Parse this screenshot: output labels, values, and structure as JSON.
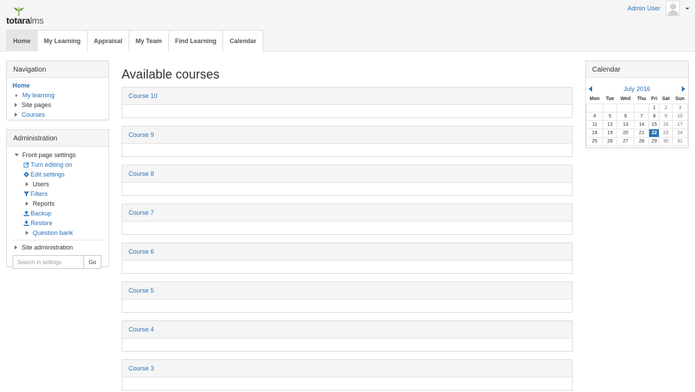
{
  "brand": {
    "logo_bold": "totara",
    "logo_light": "lms",
    "leaf_color": "#6a9a32"
  },
  "user": {
    "name": "Admin User"
  },
  "tabs": [
    {
      "label": "Home",
      "active": true
    },
    {
      "label": "My Learning"
    },
    {
      "label": "Appraisal"
    },
    {
      "label": "My Team"
    },
    {
      "label": "Find Learning"
    },
    {
      "label": "Calendar"
    }
  ],
  "navigation": {
    "title": "Navigation",
    "home": "Home",
    "my_learning": "My learning",
    "site_pages": "Site pages",
    "courses": "Courses"
  },
  "administration": {
    "title": "Administration",
    "front_page_settings": "Front page settings",
    "turn_editing_on": "Turn editing on",
    "edit_settings": "Edit settings",
    "users": "Users",
    "filters": "Filters",
    "reports": "Reports",
    "backup": "Backup",
    "restore": "Restore",
    "question_bank": "Question bank",
    "site_administration": "Site administration",
    "search_placeholder": "Search in settings",
    "go_label": "Go"
  },
  "main": {
    "title": "Available courses",
    "courses": [
      "Course 10",
      "Course 9",
      "Course 8",
      "Course 7",
      "Course 6",
      "Course 5",
      "Course 4",
      "Course 3"
    ]
  },
  "calendar": {
    "title": "Calendar",
    "month": "July 2016",
    "weekdays": [
      "Mon",
      "Tue",
      "Wed",
      "Thu",
      "Fri",
      "Sat",
      "Sun"
    ],
    "weeks": [
      [
        "",
        "",
        "",
        "",
        "1",
        "2",
        "3"
      ],
      [
        "4",
        "5",
        "6",
        "7",
        "8",
        "9",
        "10"
      ],
      [
        "11",
        "12",
        "13",
        "14",
        "15",
        "16",
        "17"
      ],
      [
        "18",
        "19",
        "20",
        "21",
        "22",
        "23",
        "24"
      ],
      [
        "25",
        "26",
        "27",
        "28",
        "29",
        "30",
        "31"
      ]
    ],
    "today": "22",
    "accent": "#2a73b8"
  }
}
